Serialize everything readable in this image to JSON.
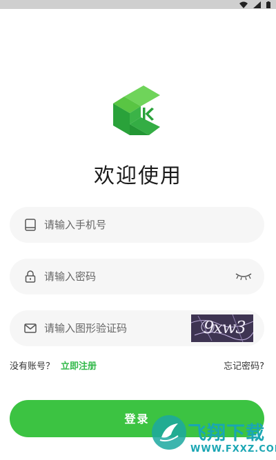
{
  "status_bar": {
    "icons": [
      "wifi-icon",
      "signal-icon",
      "battery-icon"
    ]
  },
  "colors": {
    "accent": "#3cc342",
    "register_link": "#32b94a",
    "field_bg": "#f6f6f6",
    "watermark": "#1aa6b3"
  },
  "welcome_title": "欢迎使用",
  "form": {
    "phone_placeholder": "请输入手机号",
    "password_placeholder": "请输入密码",
    "captcha_placeholder": "请输入图形验证码",
    "captcha_text": "9xw3"
  },
  "links": {
    "no_account": "没有账号？",
    "register": "立即注册",
    "forgot_password": "忘记密码?"
  },
  "login_button": "登录",
  "watermark": {
    "name": "飞翔下载",
    "url": "WWW.FXXZ.COM"
  }
}
